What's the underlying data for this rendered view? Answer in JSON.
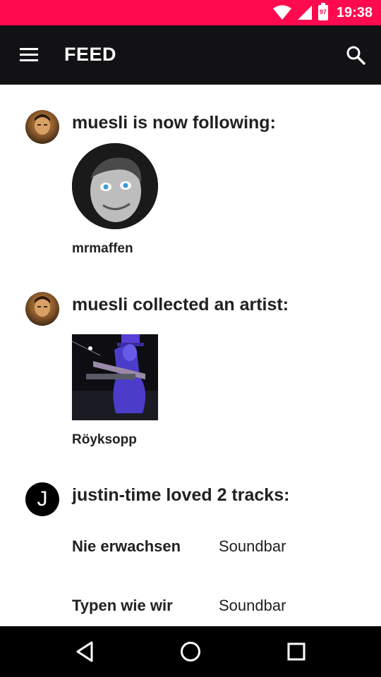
{
  "status_bar": {
    "time": "19:38",
    "battery_level": "97",
    "background_color": "#ff0a4f",
    "icons": [
      "wifi-icon",
      "cell-signal-icon",
      "battery-icon"
    ]
  },
  "toolbar": {
    "title": "FEED",
    "background_color": "#121215",
    "icons": [
      "menu-icon",
      "search-icon"
    ]
  },
  "feed": {
    "items": [
      {
        "avatar": "user-avatar-photo",
        "title": "muesli is now following:",
        "target_caption": "mrmaffen"
      },
      {
        "avatar": "user-avatar-photo",
        "title": "muesli collected an artist:",
        "target_caption": "Röyksopp"
      },
      {
        "avatar_letter": "J",
        "title": "justin-time loved 2 tracks:",
        "tracks": [
          {
            "name": "Nie erwachsen",
            "source": "Soundbar"
          },
          {
            "name": "Typen wie wir",
            "source": "Soundbar"
          }
        ]
      }
    ]
  },
  "nav_bar": {
    "icons": [
      "back-icon",
      "home-icon",
      "recents-icon"
    ]
  }
}
